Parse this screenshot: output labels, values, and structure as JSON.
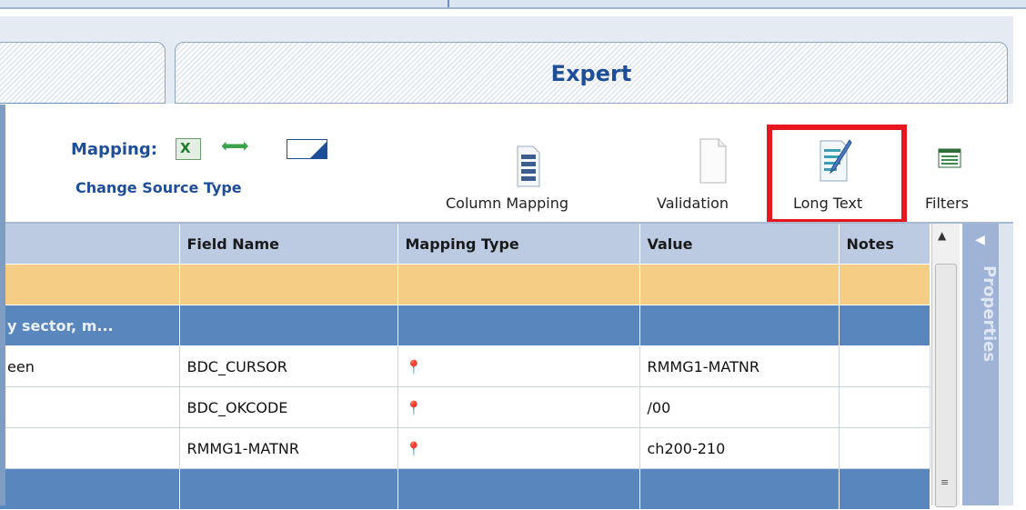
{
  "tabs": [
    {
      "label": ""
    },
    {
      "label": "Expert"
    }
  ],
  "toolbar": {
    "mapping_label": "Mapping:",
    "change_source_type": "Change Source Type",
    "column_mapping": "Column Mapping",
    "validation": "Validation",
    "long_text": "Long Text",
    "filters": "Filters"
  },
  "grid": {
    "columns": [
      "",
      "Field Name",
      "Mapping Type",
      "Value",
      "Notes"
    ],
    "rows": [
      {
        "style": "orange",
        "cells": [
          "",
          "",
          "",
          "",
          ""
        ]
      },
      {
        "style": "blue",
        "cells": [
          "y sector, m...",
          "",
          "",
          "",
          ""
        ]
      },
      {
        "style": "white",
        "cells": [
          "een",
          "BDC_CURSOR",
          "pin-icon",
          "RMMG1-MATNR",
          ""
        ]
      },
      {
        "style": "white",
        "cells": [
          "",
          "BDC_OKCODE",
          "pin-icon",
          "/00",
          ""
        ]
      },
      {
        "style": "white",
        "cells": [
          "",
          "RMMG1-MATNR",
          "pin-icon",
          "ch200-210",
          ""
        ]
      },
      {
        "style": "blue",
        "cells": [
          "",
          "",
          "",
          "",
          ""
        ]
      }
    ]
  },
  "side_panel": {
    "label": "Properties"
  },
  "colors": {
    "accent": "#1f4e98",
    "highlight": "#e8171f",
    "group_row": "#5a86be",
    "header_row": "#f5cd85"
  },
  "icons": [
    "excel-icon",
    "arrows-icon",
    "target-box-icon",
    "column-mapping-icon",
    "validation-icon",
    "long-text-icon",
    "filters-icon",
    "pin-icon"
  ]
}
